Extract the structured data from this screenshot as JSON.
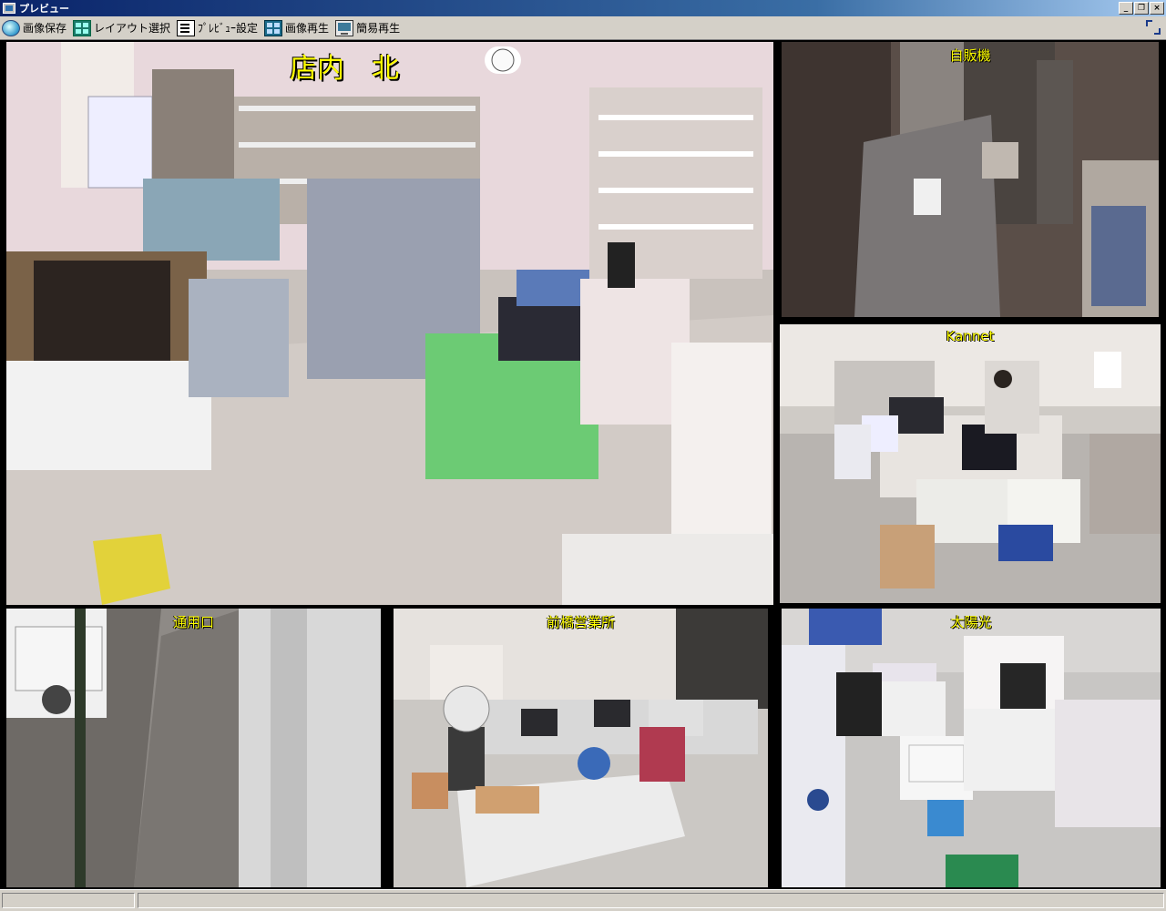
{
  "window": {
    "title": "プレビュー",
    "buttons": {
      "minimize": "_",
      "restore": "❐",
      "close": "×"
    }
  },
  "toolbar": {
    "items": [
      {
        "label": "画像保存",
        "icon": "save-image-icon"
      },
      {
        "label": "レイアウト選択",
        "icon": "layout-select-icon"
      },
      {
        "label": "ﾌﾟﾚﾋﾞｭｰ設定",
        "icon": "preview-settings-icon"
      },
      {
        "label": "画像再生",
        "icon": "image-playback-icon"
      },
      {
        "label": "簡易再生",
        "icon": "simple-playback-icon"
      }
    ],
    "right_icon": "fullscreen-toggle-icon"
  },
  "cameras": [
    {
      "id": "cam1",
      "label": "店内　北"
    },
    {
      "id": "cam2",
      "label": "自販機"
    },
    {
      "id": "cam3",
      "label": "Kannet"
    },
    {
      "id": "cam4",
      "label": "通用口"
    },
    {
      "id": "cam5",
      "label": "前橋営業所"
    },
    {
      "id": "cam6",
      "label": "太陽光"
    }
  ],
  "statusbar": {
    "panel1": "",
    "panel2": ""
  },
  "colors": {
    "titlebar": "#0a246a",
    "label": "#ffff00",
    "chrome": "#d4d0c8"
  }
}
